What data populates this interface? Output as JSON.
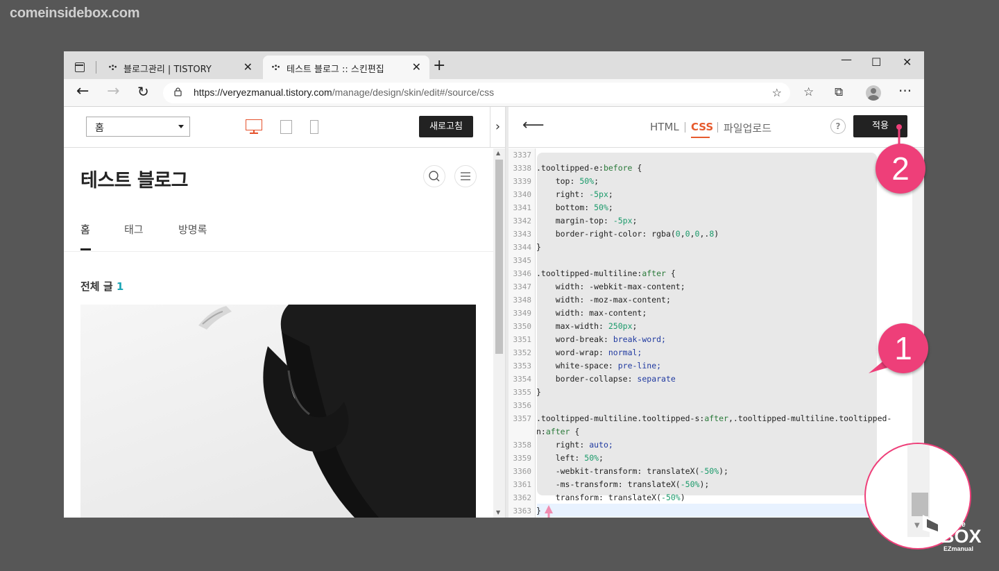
{
  "watermark": "comeinsidebox.com",
  "browser": {
    "tabs": [
      {
        "label": "블로그관리 | TISTORY",
        "active": false
      },
      {
        "label": "테스트 블로그 :: 스킨편집",
        "active": true
      }
    ],
    "url_host": "https://veryezmanual.tistory.com",
    "url_path": "/manage/design/skin/edit#/source/css"
  },
  "left_pane": {
    "view_select": "홈",
    "refresh_label": "새로고침",
    "blog_title": "테스트 블로그",
    "menu": [
      "홈",
      "태그",
      "방명록"
    ],
    "post_count_label": "전체 글",
    "post_count": "1"
  },
  "right_pane": {
    "tabs": [
      "HTML",
      "CSS",
      "파일업로드"
    ],
    "active_tab": "CSS",
    "help_label": "?",
    "apply_label": "적용",
    "accent_color": "#e65a2d"
  },
  "code_lines": [
    {
      "n": "3337",
      "t": ""
    },
    {
      "n": "3338",
      "t": ".tooltipped-e:before {"
    },
    {
      "n": "3339",
      "t": "    top: 50%;"
    },
    {
      "n": "3340",
      "t": "    right: -5px;"
    },
    {
      "n": "3341",
      "t": "    bottom: 50%;"
    },
    {
      "n": "3342",
      "t": "    margin-top: -5px;"
    },
    {
      "n": "3343",
      "t": "    border-right-color: rgba(0,0,0,.8)"
    },
    {
      "n": "3344",
      "t": "}"
    },
    {
      "n": "3345",
      "t": ""
    },
    {
      "n": "3346",
      "t": ".tooltipped-multiline:after {"
    },
    {
      "n": "3347",
      "t": "    width: -webkit-max-content;"
    },
    {
      "n": "3348",
      "t": "    width: -moz-max-content;"
    },
    {
      "n": "3349",
      "t": "    width: max-content;"
    },
    {
      "n": "3350",
      "t": "    max-width: 250px;"
    },
    {
      "n": "3351",
      "t": "    word-break: break-word;"
    },
    {
      "n": "3352",
      "t": "    word-wrap: normal;"
    },
    {
      "n": "3353",
      "t": "    white-space: pre-line;"
    },
    {
      "n": "3354",
      "t": "    border-collapse: separate"
    },
    {
      "n": "3355",
      "t": "}"
    },
    {
      "n": "3356",
      "t": ""
    },
    {
      "n": "3357",
      "t": ".tooltipped-multiline.tooltipped-s:after,.tooltipped-multiline.tooltipped-"
    },
    {
      "n": "",
      "t": "n:after {"
    },
    {
      "n": "3358",
      "t": "    right: auto;"
    },
    {
      "n": "3359",
      "t": "    left: 50%;"
    },
    {
      "n": "3360",
      "t": "    -webkit-transform: translateX(-50%);"
    },
    {
      "n": "3361",
      "t": "    -ms-transform: translateX(-50%);"
    },
    {
      "n": "3362",
      "t": "    transform: translateX(-50%)"
    },
    {
      "n": "3363",
      "t": "}"
    }
  ],
  "annotations": {
    "badge_1": "1",
    "badge_2": "2",
    "badge_color": "#ee3f79"
  },
  "logo": {
    "top": "inside",
    "middle": "BOX",
    "bottom": "EZmanual"
  }
}
